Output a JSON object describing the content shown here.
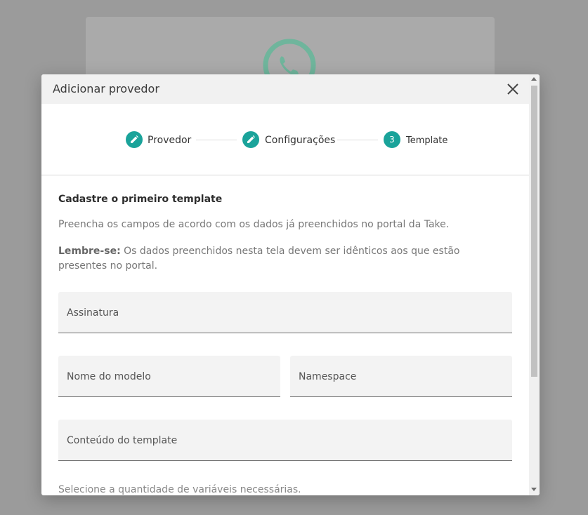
{
  "modal": {
    "title": "Adicionar provedor"
  },
  "stepper": {
    "steps": [
      {
        "label": "Provedor",
        "state": "completed",
        "icon": "pencil-icon"
      },
      {
        "label": "Configurações",
        "state": "completed",
        "icon": "pencil-icon"
      },
      {
        "label": "Template",
        "state": "active",
        "number": "3"
      }
    ]
  },
  "content": {
    "title": "Cadastre o primeiro template",
    "description": "Preencha os campos de acordo com os dados já preenchidos no portal da Take.",
    "reminder_label": "Lembre-se:",
    "reminder_text": " Os dados preenchidos nesta tela devem ser idênticos aos que estão presentes no portal.",
    "fields": {
      "signature": "Assinatura",
      "model_name": "Nome do modelo",
      "namespace": "Namespace",
      "template_content": "Conteúdo do template"
    },
    "variables_hint": "Selecione a quantidade de variáveis necessárias."
  },
  "colors": {
    "accent": "#1aa39a",
    "overlay": "#9b9b9b",
    "header_bg": "#f1f1f1",
    "field_bg": "#f3f3f3"
  }
}
